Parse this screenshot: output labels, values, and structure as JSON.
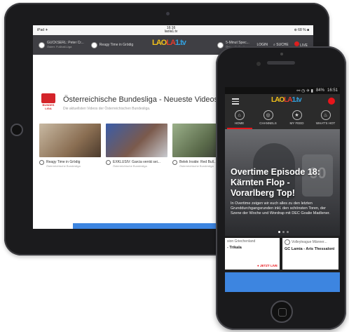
{
  "ipad": {
    "status": {
      "left": "iPad ✈",
      "time": "16:16",
      "url": "laola1.tv",
      "right": "⊕ 68 % ■"
    },
    "header": {
      "items": [
        {
          "title": "GUCKSERL: Peter Cr...",
          "sub": "Österr. Fußball-Liga"
        },
        {
          "title": "Reagy Time in Grödig",
          "sub": ""
        },
        {
          "title": "5-Minut Spec...",
          "sub": "Österr. Fußball"
        }
      ],
      "logo_a": "LAO",
      "logo_b": "LA",
      "logo_c": "1.tv",
      "login": "LOGIN",
      "search": "SUCHE",
      "live": "LIVE"
    },
    "section": {
      "logo_label": "BUNDES LIGA",
      "title": "Österreichische Bundesliga - Neueste Videos",
      "subtitle": "Die aktuellsten Videos der Österreichischen Bundesliga."
    },
    "videos": [
      {
        "title": "Reagy Time in Grödig",
        "sub": "Österreichische Bundesliga",
        "color": "#8a6e52"
      },
      {
        "title": "EXKLUSIV: Garcia verrät sei...",
        "sub": "Österreichische Bundesliga",
        "color": "#7b5a4c"
      },
      {
        "title": "Belek Inside: Red Bull...",
        "sub": "Österreichische Bundesliga",
        "color": "#5a6a4a"
      }
    ]
  },
  "iphone": {
    "status": {
      "icons": "⚯ ◷ ✈ ▮",
      "battery": "84%",
      "time": "16:51"
    },
    "logo_a": "LAO",
    "logo_b": "LA",
    "logo_c": "1.tv",
    "tabs": [
      {
        "label": "HOME",
        "icon": "⌂"
      },
      {
        "label": "CHANNELS",
        "icon": "◎"
      },
      {
        "label": "MY FEED",
        "icon": "★"
      },
      {
        "label": "WHAT'S HOT",
        "icon": "♨"
      }
    ],
    "hero": {
      "jersey": "60",
      "title": "Overtime Episode 18: Kärnten Flop - Vorarlberg Top!",
      "body": "In Overtime zeigen wir euch alles zu den letzten Grunddurchgangsrunden inkl. den schönsten Toren, der Szene der Woche und Wordrap mit DEC Goalie Madlener."
    },
    "cards": [
      {
        "league": "sion Griechenland",
        "match": "- Trikala",
        "live": "● JETZT LIVE"
      },
      {
        "league": "Volleyleague Männer...",
        "match": "GC Lamia - Aris Thessaloni",
        "live": ""
      }
    ]
  }
}
